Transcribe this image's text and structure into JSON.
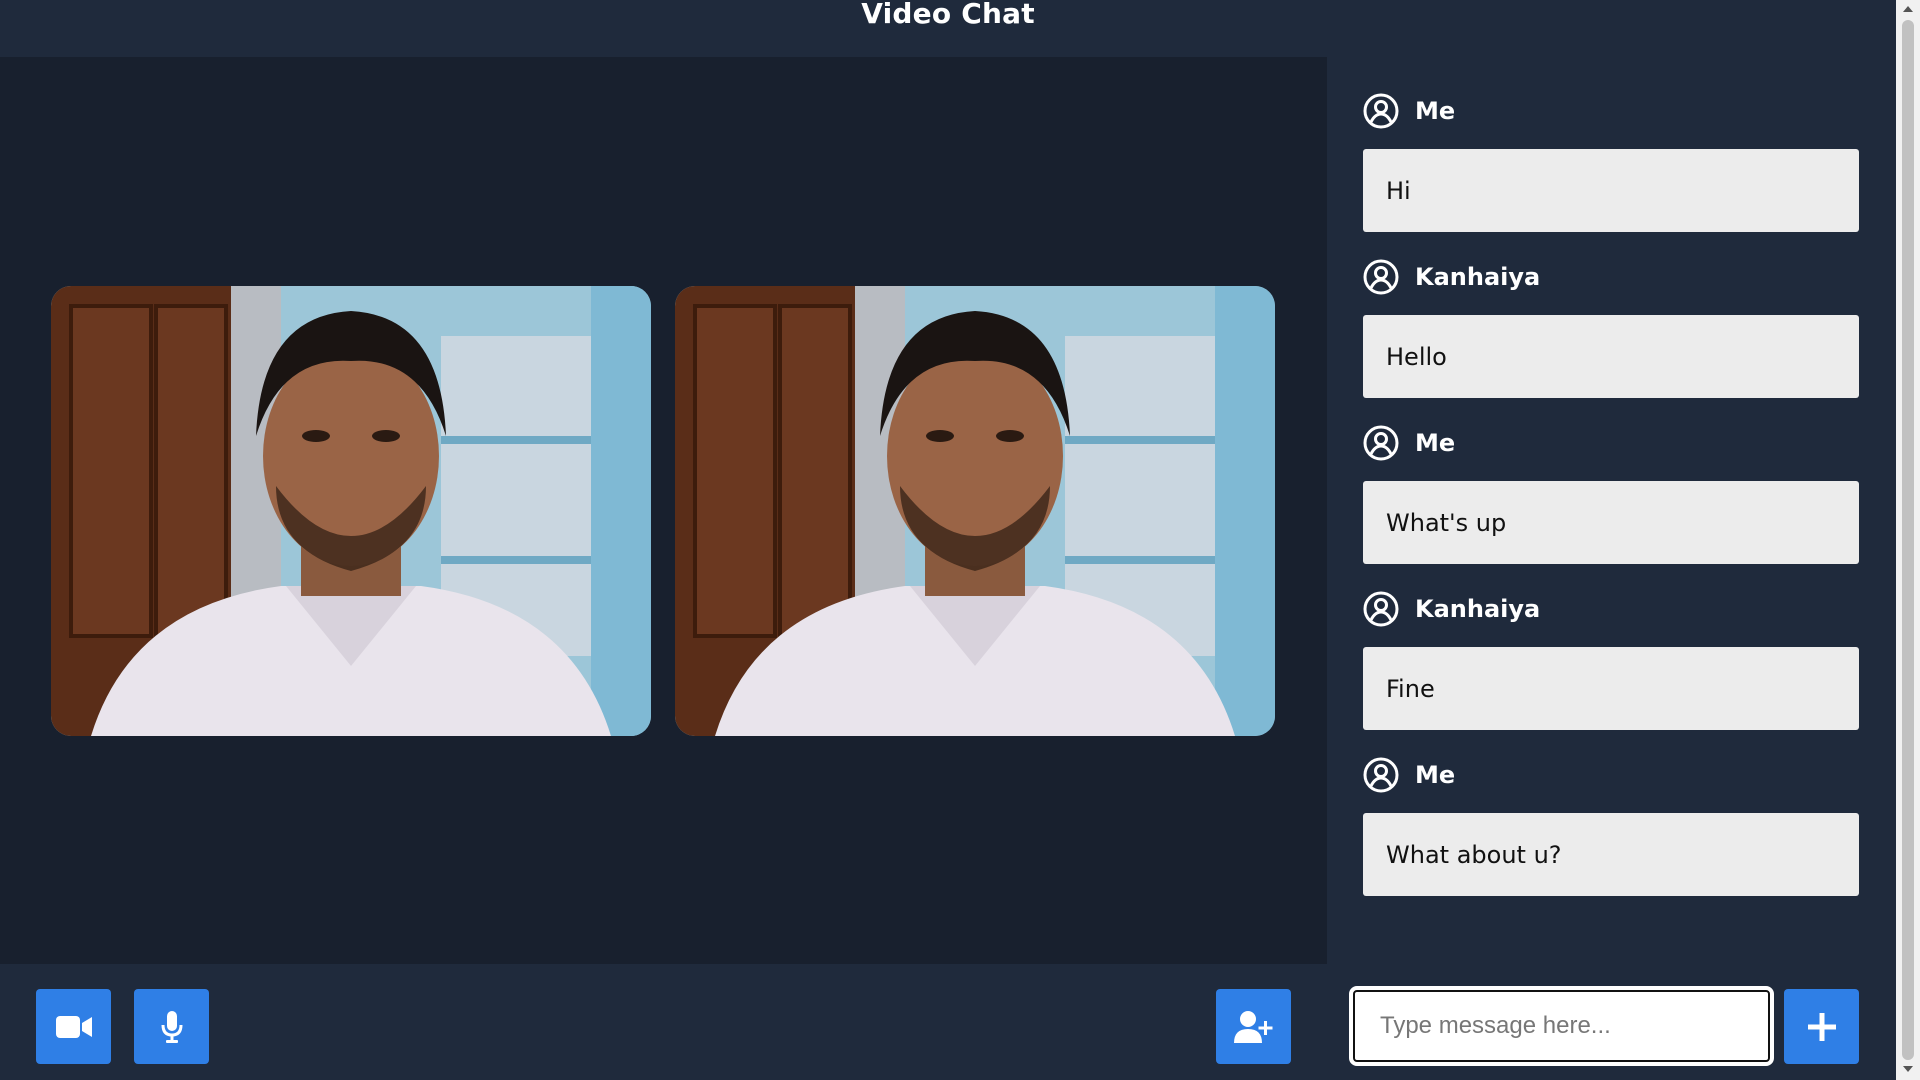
{
  "header": {
    "title": "Video Chat"
  },
  "videos": [
    {
      "label": "local-video"
    },
    {
      "label": "remote-video"
    }
  ],
  "controls": {
    "camera_icon": "video-camera-icon",
    "mic_icon": "microphone-icon",
    "invite_icon": "add-user-icon"
  },
  "chat": {
    "messages": [
      {
        "author": "Me",
        "text": "Hi"
      },
      {
        "author": "Kanhaiya",
        "text": "Hello"
      },
      {
        "author": "Me",
        "text": "What's up"
      },
      {
        "author": "Kanhaiya",
        "text": "Fine"
      },
      {
        "author": "Me",
        "text": "What about u?"
      }
    ],
    "input_placeholder": "Type message here...",
    "send_icon": "plus-icon"
  },
  "colors": {
    "accent": "#2f7fe6",
    "background": "#18202e",
    "panel": "#1f2a3c",
    "bubble": "#ececec"
  }
}
